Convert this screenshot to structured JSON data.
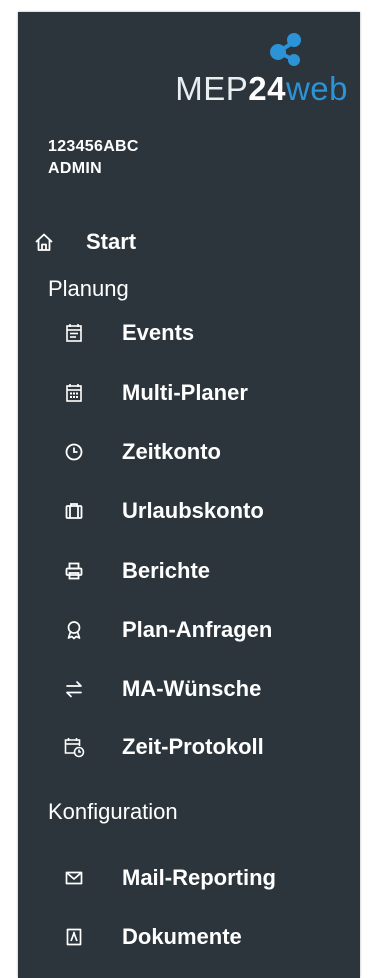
{
  "logo": {
    "part1": "MEP",
    "part2": "24",
    "part3": "web",
    "colors": {
      "text": "#e9eef1",
      "accent": "#2c93d6"
    }
  },
  "user": {
    "id": "123456ABC",
    "role": "ADMIN"
  },
  "nav": {
    "start": {
      "label": "Start",
      "icon": "home-icon"
    },
    "planung": {
      "heading": "Planung",
      "items": [
        {
          "label": "Events",
          "icon": "event-sheet-icon"
        },
        {
          "label": "Multi-Planer",
          "icon": "calendar-icon"
        },
        {
          "label": "Zeitkonto",
          "icon": "clock-icon"
        },
        {
          "label": "Urlaubskonto",
          "icon": "suitcase-icon"
        },
        {
          "label": "Berichte",
          "icon": "printer-icon"
        },
        {
          "label": "Plan-Anfragen",
          "icon": "award-icon"
        },
        {
          "label": "MA-Wünsche",
          "icon": "swap-arrows-icon"
        },
        {
          "label": "Zeit-Protokoll",
          "icon": "calendar-clock-icon"
        }
      ]
    },
    "konfiguration": {
      "heading": "Konfiguration",
      "items": [
        {
          "label": "Mail-Reporting",
          "icon": "mail-icon"
        },
        {
          "label": "Dokumente",
          "icon": "document-icon"
        }
      ]
    }
  },
  "colors": {
    "sidebar_bg": "#2b353b",
    "text": "#ffffff"
  }
}
